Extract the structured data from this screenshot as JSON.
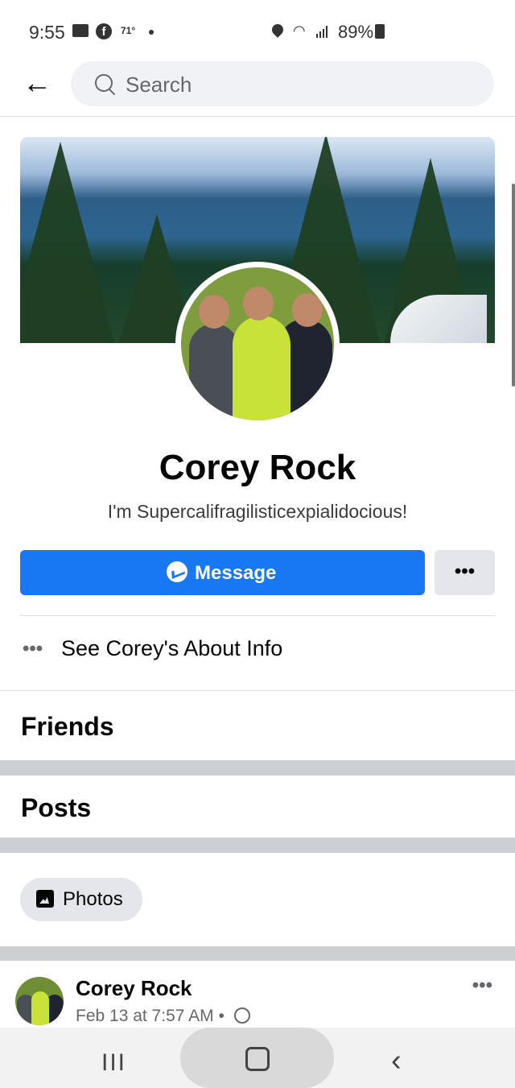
{
  "status_bar": {
    "time": "9:55",
    "temperature": "71°",
    "battery": "89%"
  },
  "search": {
    "placeholder": "Search"
  },
  "profile": {
    "name": "Corey Rock",
    "bio": "I'm Supercalifragilisticexpialidocious!",
    "message_label": "Message",
    "more_label": "•••",
    "about_label": "See Corey's About Info",
    "about_dots": "•••"
  },
  "sections": {
    "friends": "Friends",
    "posts": "Posts",
    "photos": "Photos"
  },
  "post": {
    "author": "Corey Rock",
    "time": "Feb 13 at 7:57 AM",
    "separator": "•",
    "more": "•••"
  },
  "colors": {
    "accent": "#1877f2",
    "divider": "#ccd0d5"
  }
}
